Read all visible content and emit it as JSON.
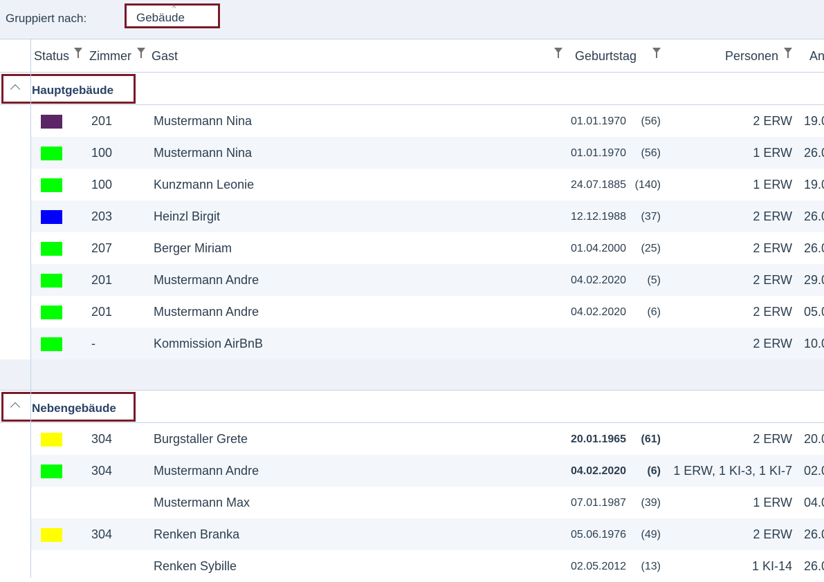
{
  "grouping": {
    "label": "Gruppiert nach:",
    "value": "Gebäude"
  },
  "columns": {
    "status": "Status",
    "room": "Zimmer",
    "guest": "Gast",
    "birthday": "Geburtstag",
    "persons": "Personen",
    "arrival": "An"
  },
  "groups": [
    {
      "title": "Hauptgebäude",
      "rows": [
        {
          "color": "#5c2566",
          "room": "201",
          "guest": "Mustermann Nina",
          "birthday": "01.01.1970",
          "age": "(56)",
          "persons": "2 ERW",
          "arrival": "19.0"
        },
        {
          "color": "#00ff00",
          "room": "100",
          "guest": "Mustermann Nina",
          "birthday": "01.01.1970",
          "age": "(56)",
          "persons": "1 ERW",
          "arrival": "26.0"
        },
        {
          "color": "#00ff00",
          "room": "100",
          "guest": "Kunzmann Leonie",
          "birthday": "24.07.1885",
          "age": "(140)",
          "persons": "1 ERW",
          "arrival": "19.0"
        },
        {
          "color": "#0000ff",
          "room": "203",
          "guest": "Heinzl Birgit",
          "birthday": "12.12.1988",
          "age": "(37)",
          "persons": "2 ERW",
          "arrival": "26.0"
        },
        {
          "color": "#00ff00",
          "room": "207",
          "guest": "Berger Miriam",
          "birthday": "01.04.2000",
          "age": "(25)",
          "persons": "2 ERW",
          "arrival": "26.0"
        },
        {
          "color": "#00ff00",
          "room": "201",
          "guest": "Mustermann Andre",
          "birthday": "04.02.2020",
          "age": "(5)",
          "persons": "2 ERW",
          "arrival": "29.0"
        },
        {
          "color": "#00ff00",
          "room": "201",
          "guest": "Mustermann Andre",
          "birthday": "04.02.2020",
          "age": "(6)",
          "persons": "2 ERW",
          "arrival": "05.0"
        },
        {
          "color": "#00ff00",
          "room": "-",
          "guest": "Kommission AirBnB",
          "birthday": "",
          "age": "",
          "persons": "2 ERW",
          "arrival": "10.0"
        }
      ]
    },
    {
      "title": "Nebengebäude",
      "rows": [
        {
          "color": "#ffff00",
          "room": "304",
          "guest": "Burgstaller Grete",
          "birthday": "20.01.1965",
          "age": "(61)",
          "bold": true,
          "persons": "2 ERW",
          "arrival": "20.0"
        },
        {
          "color": "#00ff00",
          "room": "304",
          "guest": "Mustermann Andre",
          "birthday": "04.02.2020",
          "age": "(6)",
          "bold": true,
          "persons": "1 ERW, 1 KI-3, 1 KI-7",
          "arrival": "02.0"
        },
        {
          "color": "",
          "room": "",
          "guest": "Mustermann Max",
          "birthday": "07.01.1987",
          "age": "(39)",
          "persons": "1 ERW",
          "arrival": "04.0"
        },
        {
          "color": "#ffff00",
          "room": "304",
          "guest": "Renken Branka",
          "birthday": "05.06.1976",
          "age": "(49)",
          "persons": "2 ERW",
          "arrival": "26.0"
        },
        {
          "color": "",
          "room": "",
          "guest": "Renken Sybille",
          "birthday": "02.05.2012",
          "age": "(13)",
          "persons": "1 KI-14",
          "arrival": "26.0"
        }
      ]
    }
  ]
}
